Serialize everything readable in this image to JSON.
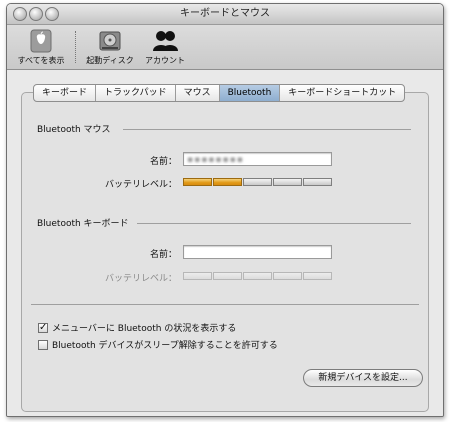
{
  "window": {
    "title": "キーボードとマウス"
  },
  "toolbar": {
    "show_all_label": "すべてを表示",
    "startup_disk_label": "起動ディスク",
    "accounts_label": "アカウント"
  },
  "tabs": [
    {
      "label": "キーボード",
      "active": false
    },
    {
      "label": "トラックパッド",
      "active": false
    },
    {
      "label": "マウス",
      "active": false
    },
    {
      "label": "Bluetooth",
      "active": true
    },
    {
      "label": "キーボードショートカット",
      "active": false
    }
  ],
  "mouse_section": {
    "title": "Bluetooth マウス",
    "name_label": "名前：",
    "name_value": "▪▪▪▪▪▪▪▪",
    "battery_label": "バッテリレベル：",
    "battery_level_of_5": 2
  },
  "keyboard_section": {
    "title": "Bluetooth キーボード",
    "name_label": "名前：",
    "name_value": "",
    "battery_label": "バッテリレベル：",
    "battery_level_of_5": 0
  },
  "options": {
    "show_in_menu_label": "メニューバーに Bluetooth の状況を表示する",
    "show_in_menu_checked": true,
    "allow_wake_label": "Bluetooth デバイスがスリープ解除することを許可する",
    "allow_wake_checked": false
  },
  "buttons": {
    "setup_new_device": "新規デバイスを設定..."
  },
  "colors": {
    "battery_fill": "#e19a17",
    "tab_active": "#8eaecf"
  }
}
